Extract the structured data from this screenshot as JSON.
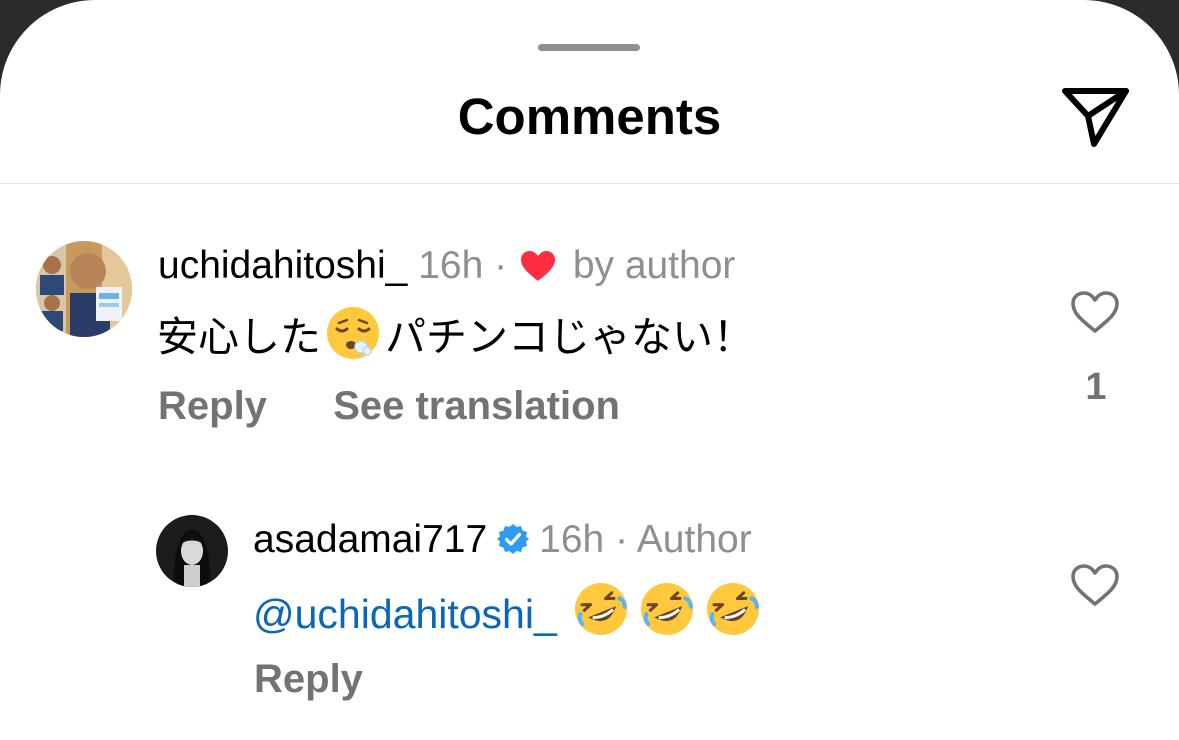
{
  "header": {
    "title": "Comments",
    "send_icon": "paper-plane-icon"
  },
  "comments": [
    {
      "username": "uchidahitoshi_",
      "time": "16h",
      "separator": "·",
      "liked_by_author_label": "by author",
      "text_before": "安心した",
      "emoji": "relieved-face",
      "text_after": "パチンコじゃない！",
      "reply_label": "Reply",
      "translation_label": "See translation",
      "like_count": "1"
    },
    {
      "username": "asadamai717",
      "verified": true,
      "time": "16h",
      "separator": "·",
      "author_label": "Author",
      "mention": "@uchidahitoshi_",
      "emojis": [
        "rolling-on-floor-laughing",
        "rolling-on-floor-laughing",
        "rolling-on-floor-laughing"
      ],
      "reply_label": "Reply"
    }
  ],
  "colors": {
    "heart_red": "#ff2d3f",
    "verified_blue": "#2f9bf0",
    "mention_blue": "#0a66b8",
    "secondary_text": "#737373"
  }
}
